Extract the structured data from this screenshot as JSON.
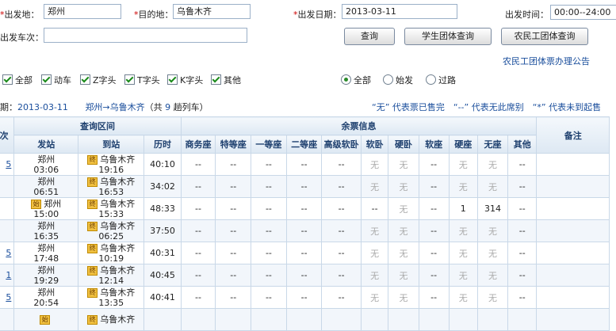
{
  "search": {
    "from_label": "出发地：",
    "from_value": "郑州",
    "to_label": "目的地：",
    "to_value": "乌鲁木齐",
    "date_label": "出发日期：",
    "date_value": "2013-03-11",
    "time_label": "出发时间：",
    "time_value": "00:00--24:00",
    "train_label": "出发车次：",
    "train_value": "",
    "query_btn": "查询",
    "student_btn": "学生团体查询",
    "migrant_btn": "农民工团体查询",
    "migrant_notice": "农民工团体票办理公告"
  },
  "filters": {
    "types": [
      "全部",
      "动车",
      "Z字头",
      "T字头",
      "K字头",
      "其他"
    ],
    "origin": [
      "全部",
      "始发",
      "过路"
    ]
  },
  "summary": {
    "date_prefix": "期：",
    "date": "2013-03-11",
    "route": "郑州→乌鲁木齐",
    "count_pre": "（共",
    "count": "9",
    "count_post": "趟列车）",
    "legend": "“无” 代表票已售完　“--” 代表无此席别　“*” 代表未到起售"
  },
  "table": {
    "h_train": "次",
    "h_interval": "查询区间",
    "h_tickets": "余票信息",
    "h_remark": "备注",
    "h_from": "发站",
    "h_to": "到站",
    "h_duration": "历时",
    "seat_headers": [
      "商务座",
      "特等座",
      "一等座",
      "二等座",
      "高级软卧",
      "软卧",
      "硬卧",
      "软座",
      "硬座",
      "无座",
      "其他"
    ],
    "rows": [
      {
        "no": "5",
        "from_tag": "",
        "from": "郑州",
        "dep": "03:06",
        "to_tag": "终",
        "to": "乌鲁木齐",
        "arr": "19:16",
        "dur": "40:10",
        "seats": [
          "--",
          "--",
          "--",
          "--",
          "--",
          "无",
          "无",
          "--",
          "无",
          "无",
          "--"
        ]
      },
      {
        "no": "",
        "from_tag": "",
        "from": "郑州",
        "dep": "06:51",
        "to_tag": "终",
        "to": "乌鲁木齐",
        "arr": "16:53",
        "dur": "34:02",
        "seats": [
          "--",
          "--",
          "--",
          "--",
          "--",
          "无",
          "无",
          "--",
          "无",
          "无",
          "--"
        ]
      },
      {
        "no": "",
        "from_tag": "始",
        "from": "郑州",
        "dep": "15:00",
        "to_tag": "终",
        "to": "乌鲁木齐",
        "arr": "15:33",
        "dur": "48:33",
        "seats": [
          "--",
          "--",
          "--",
          "--",
          "--",
          "--",
          "无",
          "--",
          "1",
          "314",
          "--"
        ]
      },
      {
        "no": "",
        "from_tag": "",
        "from": "郑州",
        "dep": "16:35",
        "to_tag": "终",
        "to": "乌鲁木齐",
        "arr": "06:25",
        "dur": "37:50",
        "seats": [
          "--",
          "--",
          "--",
          "--",
          "--",
          "无",
          "无",
          "--",
          "无",
          "无",
          "--"
        ]
      },
      {
        "no": "5",
        "from_tag": "",
        "from": "郑州",
        "dep": "17:48",
        "to_tag": "终",
        "to": "乌鲁木齐",
        "arr": "10:19",
        "dur": "40:31",
        "seats": [
          "--",
          "--",
          "--",
          "--",
          "--",
          "无",
          "无",
          "--",
          "无",
          "无",
          "--"
        ]
      },
      {
        "no": "1",
        "from_tag": "",
        "from": "郑州",
        "dep": "19:29",
        "to_tag": "终",
        "to": "乌鲁木齐",
        "arr": "12:14",
        "dur": "40:45",
        "seats": [
          "--",
          "--",
          "--",
          "--",
          "--",
          "无",
          "无",
          "--",
          "无",
          "无",
          "--"
        ]
      },
      {
        "no": "5",
        "from_tag": "",
        "from": "郑州",
        "dep": "20:54",
        "to_tag": "终",
        "to": "乌鲁木齐",
        "arr": "13:35",
        "dur": "40:41",
        "seats": [
          "--",
          "--",
          "--",
          "--",
          "--",
          "无",
          "无",
          "--",
          "无",
          "无",
          "--"
        ]
      },
      {
        "no": "",
        "from_tag": "始",
        "from": "",
        "dep": "",
        "to_tag": "终",
        "to": "乌鲁木齐",
        "arr": "",
        "dur": "",
        "seats": [
          "",
          "",
          "",
          "",
          "",
          "",
          "",
          "",
          "",
          "",
          ""
        ]
      }
    ]
  }
}
